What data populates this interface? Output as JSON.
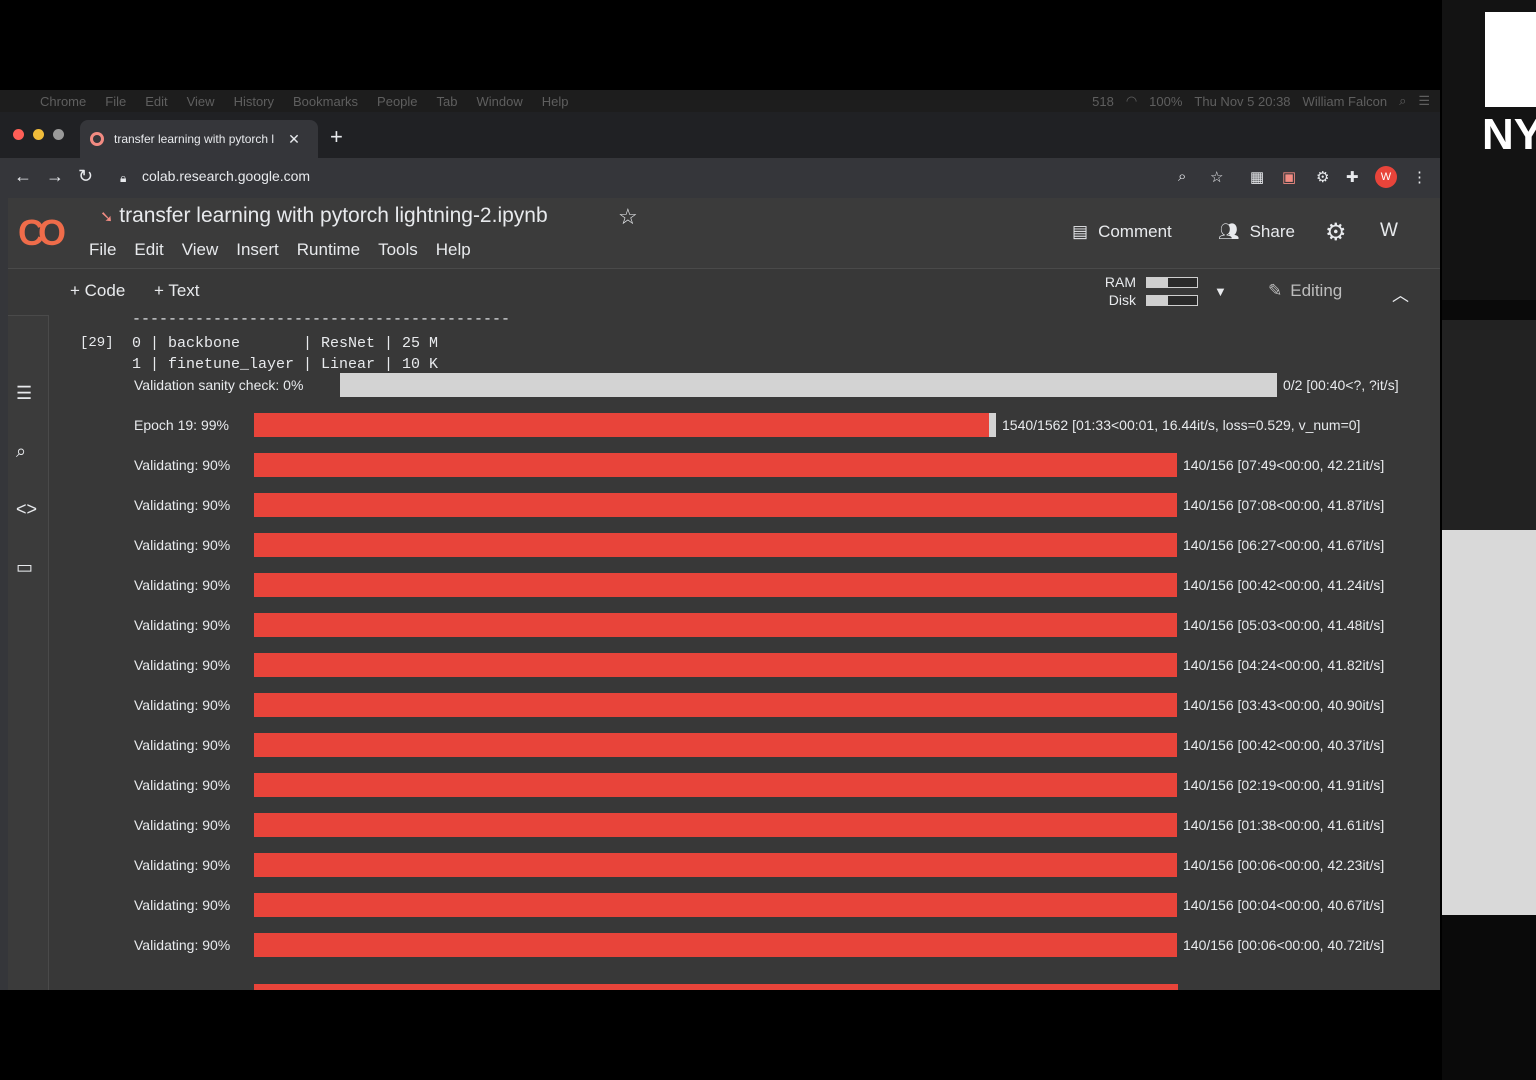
{
  "mac_menu": {
    "items": [
      "Chrome",
      "File",
      "Edit",
      "View",
      "History",
      "Bookmarks",
      "People",
      "Tab",
      "Window",
      "Help"
    ],
    "status": [
      "518",
      "100%",
      "Thu Nov 5  20:38",
      "William Falcon"
    ]
  },
  "browser": {
    "tab_title": "transfer learning with pytorch l",
    "url": "colab.research.google.com",
    "profile_letter": "W"
  },
  "colab": {
    "logo": "CO",
    "notebook_title": "transfer learning with pytorch lightning-2.ipynb",
    "menu": [
      "File",
      "Edit",
      "View",
      "Insert",
      "Runtime",
      "Tools",
      "Help"
    ],
    "comment_label": "Comment",
    "share_label": "Share",
    "user_initial": "W",
    "add_code_label": "+ Code",
    "add_text_label": "+ Text",
    "ram_label": "RAM",
    "disk_label": "Disk",
    "ram_fraction": 0.42,
    "disk_fraction": 0.42,
    "editing_label": "Editing"
  },
  "cell": {
    "exec_count": "[29]",
    "separator": "------------------------------------------",
    "table_rows": [
      "0 | backbone       | ResNet | 25 M",
      "1 | finetune_layer | Linear | 10 K"
    ],
    "sanity": {
      "label": "Validation sanity check: 0%",
      "stats": "0/2 [00:40<?, ?it/s]",
      "fraction": 0.0
    },
    "epoch": {
      "label": "Epoch 19: 99%",
      "stats": "1540/1562 [01:33<00:01, 16.44it/s, loss=0.529, v_num=0]",
      "fraction": 0.99
    },
    "validating": [
      {
        "label": "Validating: 90%",
        "stats": "140/156 [07:49<00:00, 42.21it/s]",
        "fraction": 0.9
      },
      {
        "label": "Validating: 90%",
        "stats": "140/156 [07:08<00:00, 41.87it/s]",
        "fraction": 0.9
      },
      {
        "label": "Validating: 90%",
        "stats": "140/156 [06:27<00:00, 41.67it/s]",
        "fraction": 0.9
      },
      {
        "label": "Validating: 90%",
        "stats": "140/156 [00:42<00:00, 41.24it/s]",
        "fraction": 0.9
      },
      {
        "label": "Validating: 90%",
        "stats": "140/156 [05:03<00:00, 41.48it/s]",
        "fraction": 0.9
      },
      {
        "label": "Validating: 90%",
        "stats": "140/156 [04:24<00:00, 41.82it/s]",
        "fraction": 0.9
      },
      {
        "label": "Validating: 90%",
        "stats": "140/156 [03:43<00:00, 40.90it/s]",
        "fraction": 0.9
      },
      {
        "label": "Validating: 90%",
        "stats": "140/156 [00:42<00:00, 40.37it/s]",
        "fraction": 0.9
      },
      {
        "label": "Validating: 90%",
        "stats": "140/156 [02:19<00:00, 41.91it/s]",
        "fraction": 0.9
      },
      {
        "label": "Validating: 90%",
        "stats": "140/156 [01:38<00:00, 41.61it/s]",
        "fraction": 0.9
      },
      {
        "label": "Validating: 90%",
        "stats": "140/156 [00:06<00:00, 42.23it/s]",
        "fraction": 0.9
      },
      {
        "label": "Validating: 90%",
        "stats": "140/156 [00:04<00:00, 40.67it/s]",
        "fraction": 0.9
      },
      {
        "label": "Validating: 90%",
        "stats": "140/156 [00:06<00:00, 40.72it/s]",
        "fraction": 0.9
      }
    ]
  },
  "video": {
    "nyu_text": "NY"
  },
  "colors": {
    "bar_fill": "#e8443a",
    "bar_track": "#d3d3d3",
    "logo_orange": "#ef6c4a",
    "profile_red": "#e8443a"
  }
}
